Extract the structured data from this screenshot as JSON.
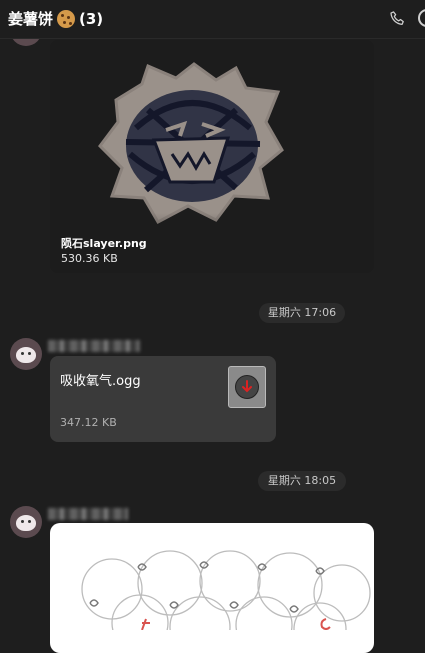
{
  "header": {
    "chat_name": "姜薯饼",
    "member_count": "(3)",
    "cookie_icon": "cookie-icon",
    "call_icon": "phone-icon"
  },
  "messages": [
    {
      "type": "image",
      "file_name": "陨石slayer.png",
      "file_size": "530.36 KB"
    },
    {
      "type": "timestamp",
      "text": "星期六 17:06"
    },
    {
      "type": "file",
      "file_name": "吸收氧气.ogg",
      "file_size": "347.12 KB",
      "icon": "audio-file-download-icon"
    },
    {
      "type": "timestamp",
      "text": "星期六 18:05"
    },
    {
      "type": "image",
      "file_name": "",
      "file_size": ""
    }
  ],
  "colors": {
    "background": "#1e1e1e",
    "bubble": "#3a3a3a",
    "timestamp_bg": "#2b2b2b"
  }
}
